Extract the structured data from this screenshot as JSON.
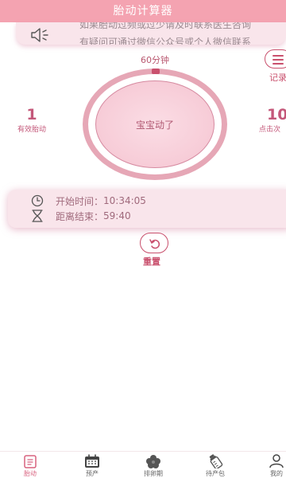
{
  "title": "胎动计算器",
  "notice": {
    "line1": "如果胎动过频或过少请及时联系医生咨询",
    "line2": "有疑问可通过微信公众号或个人微信联系",
    "icon": "speaker-icon"
  },
  "timer_label": "60分钟",
  "main_button_label": "宝宝动了",
  "stats": {
    "effective_count": "1",
    "effective_label": "有效胎动",
    "click_count": "10",
    "click_label": "点击次"
  },
  "record": {
    "label": "记录",
    "icon": "list-icon"
  },
  "info": {
    "start_label": "开始时间：",
    "start_time": "10:34:05",
    "remaining_label": "距离结束：",
    "remaining_time": "59:40"
  },
  "reset": {
    "label": "重置",
    "icon": "refresh-icon"
  },
  "tabs": [
    {
      "label": "胎动",
      "icon": "clipboard-icon",
      "active": true
    },
    {
      "label": "预产",
      "icon": "calendar-icon",
      "active": false
    },
    {
      "label": "排卵期",
      "icon": "flower-icon",
      "active": false
    },
    {
      "label": "待产包",
      "icon": "bottle-icon",
      "active": false
    },
    {
      "label": "我的",
      "icon": "person-icon",
      "active": false
    }
  ],
  "colors": {
    "accent": "#c9506d",
    "titlebar": "#f4a3b1",
    "card_bg": "#f9e5eb",
    "ring": "#e6a7b6"
  }
}
